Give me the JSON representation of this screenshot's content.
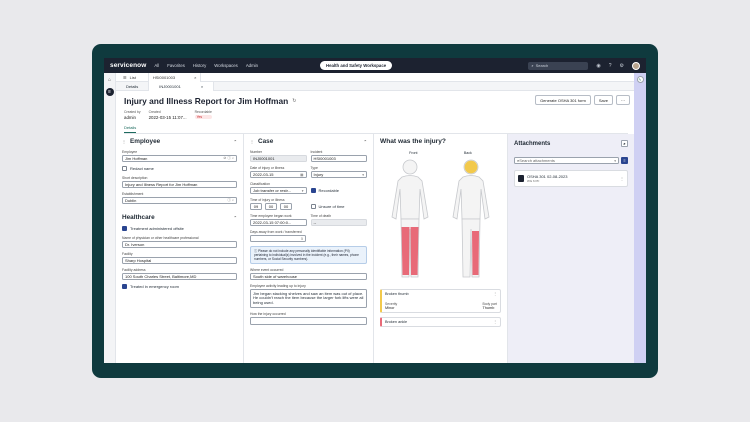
{
  "nav": {
    "logo": "servicenow",
    "links": [
      "All",
      "Favorites",
      "History",
      "Workspaces",
      "Admin"
    ],
    "workspace": "Health and Safety Workspace",
    "search_placeholder": "Search"
  },
  "tabs": {
    "list": "List",
    "record": "HSI0001003",
    "close": "×"
  },
  "subtabs": {
    "details": "Details",
    "record": "INJ0001001",
    "close": "×"
  },
  "header": {
    "title": "Injury and Illness Report for Jim Hoffman",
    "generate_button": "Generate OSHA 301 form",
    "save_button": "Save",
    "more_button": "⋯",
    "created_by_label": "Created by",
    "created_by": "admin",
    "created_label": "Created",
    "created": "2022-03-15 11:07...",
    "recordable_label": "Recordable",
    "recordable": "Yes",
    "details_tab": "Details"
  },
  "employee": {
    "title": "Employee",
    "employee_label": "Employee",
    "employee_value": "Jim Hoffman",
    "redact_label": "Redact name",
    "short_desc_label": "Short description",
    "short_desc_value": "Injury and Illness Report for Jim Hoffman",
    "establishment_label": "Establishment",
    "establishment_value": "Dublin"
  },
  "healthcare": {
    "title": "Healthcare",
    "treatment_label": "Treatment administered offsite",
    "physician_label": "Name of physician or other healthcare professional",
    "physician_value": "Dr. Iverson",
    "facility_label": "Facility",
    "facility_value": "Sharp Hospital",
    "address_label": "Facility address",
    "address_value": "100 South Charles Street, Baltimore,MD",
    "er_label": "Treated in emergency room"
  },
  "case": {
    "title": "Case",
    "number_label": "Number",
    "number_value": "INJ0001001",
    "incident_label": "Incident",
    "incident_value": "HSI0001003",
    "date_label": "Date of injury or illness",
    "date_value": "2022-03-15",
    "type_label": "Type",
    "type_value": "Injury",
    "class_label": "Classification",
    "class_value": "Job transfer or restr...",
    "recordable_label": "Recordable",
    "hours_label": "Time of injury or illness",
    "hh": "09",
    "mm": "00",
    "ss": "00",
    "unsure_label": "Unsure of time",
    "began_label": "Time employee began work",
    "began_value": "2022-03-15 07:00:0...",
    "death_label": "Time of death",
    "death_value": "--",
    "days_label": "Days away from work / transferred",
    "days_value": "5",
    "info_text": "Please do not include any personally identifiable information (PII) pertaining to individual(s) involved in the incident (e.g., their names, phone numbers, or Social Security numbers).",
    "where_label": "Where event occurred",
    "where_value": "South side of warehouse",
    "before_label": "Employee activity leading up to injury",
    "before_value": "Jim began stacking shelves and saw an item was out of place. He couldn't reach the item because the larger fork lifts were all being used.",
    "how_label": "How the injury occurred"
  },
  "injury": {
    "title": "What was the injury?",
    "front": "Front",
    "back": "Back",
    "card1_title": "Broken thumb",
    "card1_sev_label": "Severity",
    "card1_sev": "Minor",
    "card1_part_label": "Body part",
    "card1_part": "Thumb",
    "card2_title": "Broken ankle",
    "more": "⋮"
  },
  "attachments": {
    "title": "Attachments",
    "search_placeholder": "Search attachments",
    "file_name": "OSHA 301 02-08-2023",
    "file_meta": "WG 6 PF",
    "file_icon": "PDF"
  },
  "colors": {
    "nav_bg": "#1c2230",
    "device": "#0f3a3e",
    "injury_red": "#e86a78",
    "injury_yellow": "#f2c94c",
    "accent": "#2a4590"
  },
  "icons": [
    "search-icon",
    "bell-icon",
    "help-icon",
    "gear-icon",
    "home-icon",
    "pin-icon",
    "chevron-icon",
    "more-icon",
    "filter-icon",
    "file-icon"
  ]
}
